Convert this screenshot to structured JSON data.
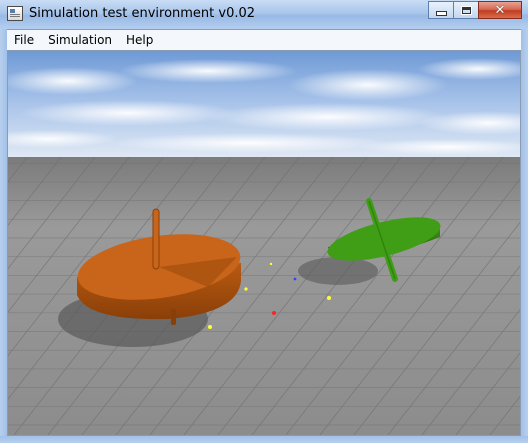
{
  "window": {
    "title": "Simulation test environment v0.02"
  },
  "caption_buttons": {
    "close_glyph": "✕"
  },
  "menu": {
    "items": [
      "File",
      "Simulation",
      "Help"
    ]
  },
  "scene": {
    "sky_color": "#7ea5d8",
    "ground_color": "#8a8a8a",
    "tops": [
      {
        "name": "orange-spinning-top",
        "color": "#c8651a"
      },
      {
        "name": "green-spinning-top",
        "color": "#3f9e16"
      }
    ],
    "marker_colors": [
      "#ffff33",
      "#ff2222",
      "#3344ff"
    ]
  }
}
